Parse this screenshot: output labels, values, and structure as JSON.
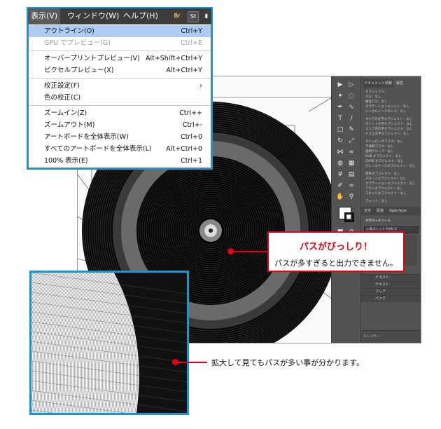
{
  "menubar": {
    "items": [
      "表示(V)",
      "ウィンドウ(W)",
      "ヘルプ(H)"
    ],
    "badges": [
      "Br",
      "St"
    ]
  },
  "menu": {
    "items": [
      {
        "label": "アウトライン(O)",
        "shortcut": "Ctrl+Y",
        "state": "selected"
      },
      {
        "label": "GPU でプレビュー(G)",
        "shortcut": "Ctrl+E",
        "state": "disabled"
      },
      {
        "label": "オーバープリントプレビュー(V)",
        "shortcut": "Alt+Shift+Ctrl+Y",
        "state": "normal"
      },
      {
        "label": "ピクセルプレビュー(X)",
        "shortcut": "Alt+Ctrl+Y",
        "state": "normal"
      },
      {
        "label": "校正設定(F)",
        "shortcut": "›",
        "state": "normal"
      },
      {
        "label": "色の校正(C)",
        "shortcut": "",
        "state": "normal"
      },
      {
        "label": "ズームイン(Z)",
        "shortcut": "Ctrl++",
        "state": "normal"
      },
      {
        "label": "ズームアウト(M)",
        "shortcut": "Ctrl+-",
        "state": "normal"
      },
      {
        "label": "アートボードを全体表示(W)",
        "shortcut": "Ctrl+0",
        "state": "normal"
      },
      {
        "label": "すべてのアートボードを全体表示(L)",
        "shortcut": "Alt+Ctrl+0",
        "state": "normal"
      },
      {
        "label": "100% 表示(E)",
        "shortcut": "Ctrl+1",
        "state": "normal"
      }
    ]
  },
  "panel": {
    "tabs": [
      "ドキュメント情報",
      "属性"
    ],
    "lines": [
      "オブジェクト：",
      "パス：なし",
      "複合パス：なし",
      "グラデーションメッシュ：なし",
      "シンボルインスタンス：なし",
      "すべての文字オブジェクト：なし",
      "ポイント文字オブジェクト：なし",
      "エリア内文字オブジェクト：なし",
      "パス上文字オブジェクト：なし",
      "クリッピングマスク：なし",
      "不透明マスク：なし",
      "透明グループ：なし",
      "RGB オブジェクト：なし",
      "CMYK オブジェクト：なし",
      "グレースケールオブジェクト：なし",
      "特色オブジェクト：なし",
      "パターンオブジェクト：なし",
      "グラデーションオブジェクト：なし",
      "ブラシオブジェクト：なし",
      "スタイルオブジェクト：なし",
      "フォント：なし"
    ],
    "type_tabs": [
      "文字",
      "段落",
      "OpenType"
    ],
    "type_tool": "文字タッチツール",
    "font_name": "小塚ゴシック Pr6N R",
    "layers": [
      "イラスト",
      "テキスト",
      "フレア",
      "バック"
    ],
    "layers_label": "4 レイヤー"
  },
  "callout": {
    "title": "パスがびっしり！",
    "text": "パスが多すぎると出力できません。"
  },
  "zoom_note": "拡大して見てもパスが多い事が分かります。",
  "colors": {
    "accent_blue": "#1a95d4",
    "accent_red": "#e60012",
    "menu_highlight": "#aecbf1",
    "menubar_bg": "#3c3c3c"
  }
}
